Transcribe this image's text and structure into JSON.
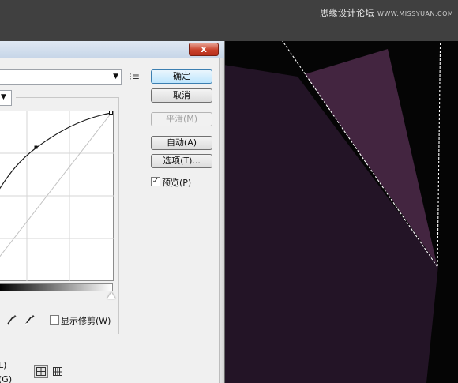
{
  "watermark": {
    "text": "思缘设计论坛",
    "site": "WWW.MISSYUAN.COM"
  },
  "dialog": {
    "close_label": "x",
    "buttons": {
      "ok": "确定",
      "cancel": "取消",
      "smooth": "平滑(M)",
      "auto": "自动(A)",
      "options": "选项(T)..."
    },
    "preview": {
      "label": "预览(P)",
      "checked": true
    },
    "show_clipping": {
      "label": "显示修剪(W)",
      "checked": false
    },
    "left_fragments": {
      "line1": "L)",
      "line2": "(G)"
    }
  },
  "icons": {
    "close": "close-icon",
    "preset_menu": "list-menu-icon",
    "dropdown": "chevron-down-icon",
    "eyedropper": "eyedropper-icon",
    "grid_simple": "grid-4-icon",
    "grid_detail": "grid-10-icon"
  },
  "colors": {
    "canvas_bg": "#050505",
    "shape_dark": "#231426",
    "shape_light": "#432540",
    "default_button": "#bee6fd"
  }
}
